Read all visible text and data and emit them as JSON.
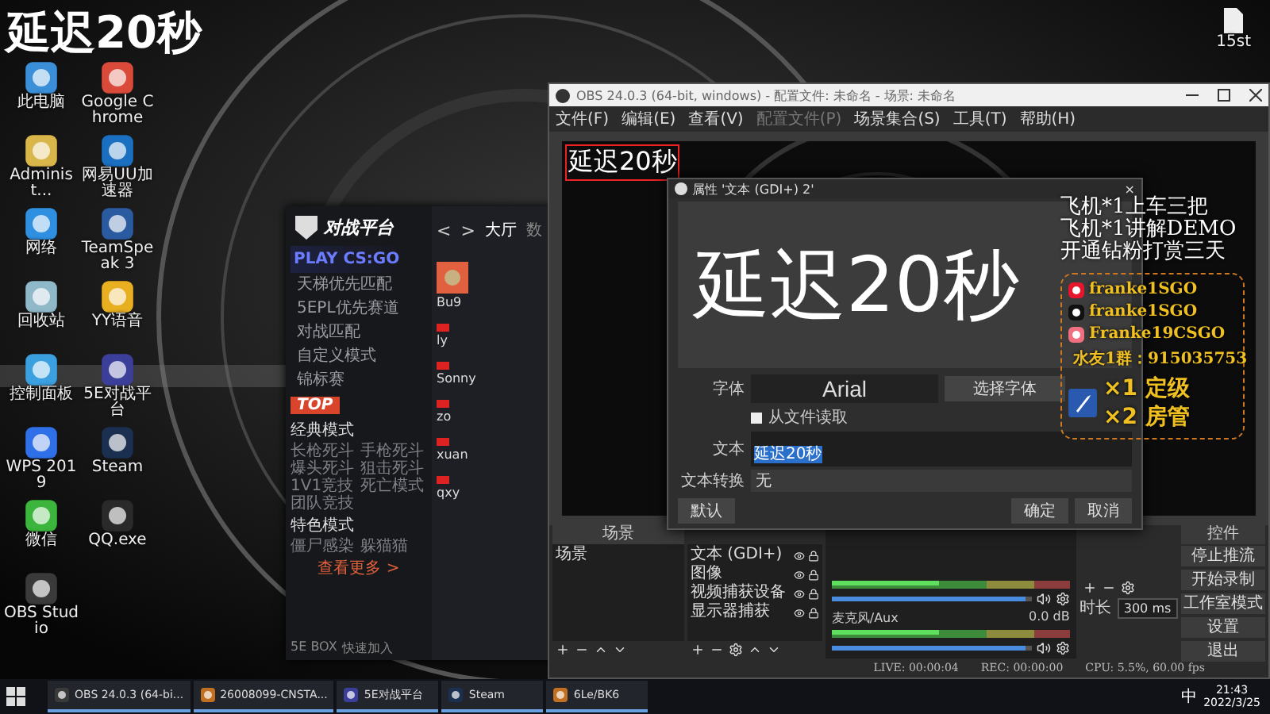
{
  "overlay_caption": "延迟20秒",
  "desktop_icons": [
    {
      "label": "此电脑",
      "kind": "computer"
    },
    {
      "label": "Google Chrome",
      "kind": "chrome"
    },
    {
      "label": "Administ...",
      "kind": "user"
    },
    {
      "label": "网易UU加速器",
      "kind": "uu"
    },
    {
      "label": "网络",
      "kind": "network"
    },
    {
      "label": "TeamSpeak 3",
      "kind": "ts"
    },
    {
      "label": "回收站",
      "kind": "bin"
    },
    {
      "label": "YY语音",
      "kind": "yy"
    },
    {
      "label": "控制面板",
      "kind": "panel"
    },
    {
      "label": "5E对战平台",
      "kind": "fivee"
    },
    {
      "label": "WPS 2019",
      "kind": "wps"
    },
    {
      "label": "Steam",
      "kind": "steam"
    },
    {
      "label": "微信",
      "kind": "wechat"
    },
    {
      "label": "QQ.exe",
      "kind": "qq"
    },
    {
      "label": "OBS Studio",
      "kind": "obs"
    }
  ],
  "file_icon": {
    "label": "15st"
  },
  "five_e": {
    "logo": "对战平台",
    "play": "PLAY CS:GO",
    "nav": {
      "back": "<",
      "forward": ">",
      "tabs": [
        {
          "label": "大厅",
          "selected": true
        },
        {
          "label": "数",
          "selected": false
        }
      ]
    },
    "menu": [
      "天梯优先匹配",
      "5EPL优先赛道",
      "对战匹配",
      "自定义模式",
      "锦标赛"
    ],
    "top_badge": "TOP",
    "sections": [
      {
        "title": "经典模式",
        "items": [
          "长枪死斗",
          "手枪死斗",
          "爆头死斗",
          "狙击死斗",
          "1V1竞技",
          "死亡模式",
          "团队竞技"
        ]
      },
      {
        "title": "特色模式",
        "items": [
          "僵尸感染",
          "躲猫猫"
        ]
      }
    ],
    "more": "查看更多 >",
    "footer": [
      "5E BOX",
      "快速加入"
    ],
    "players": [
      {
        "name": "Bu9",
        "kind": "avatar"
      },
      {
        "name": "ly",
        "kind": "flag"
      },
      {
        "name": "Sonny",
        "kind": "flag"
      },
      {
        "name": "zo",
        "kind": "flag"
      },
      {
        "name": "xuan",
        "kind": "flag"
      },
      {
        "name": "qxy",
        "kind": "flag"
      }
    ]
  },
  "obs": {
    "title": "OBS 24.0.3 (64-bit, windows) - 配置文件: 未命名 - 场景: 未命名",
    "menu": [
      {
        "label": "文件(F)",
        "disabled": false
      },
      {
        "label": "编辑(E)",
        "disabled": false
      },
      {
        "label": "查看(V)",
        "disabled": false
      },
      {
        "label": "配置文件(P)",
        "disabled": true
      },
      {
        "label": "场景集合(S)",
        "disabled": false
      },
      {
        "label": "工具(T)",
        "disabled": false
      },
      {
        "label": "帮助(H)",
        "disabled": false
      }
    ],
    "preview_selection": "延迟20秒",
    "scenes": {
      "header": "场景",
      "items": [
        "场景"
      ]
    },
    "sources": [
      "文本 (GDI+)",
      "图像",
      "视频捕获设备",
      "显示器捕获"
    ],
    "mixer": [
      {
        "level": 0.97
      },
      {
        "name": "麦克风/Aux",
        "reading": "0.0 dB",
        "level": 0.97
      }
    ],
    "transition": {
      "label": "时长",
      "value": "300 ms"
    },
    "controls": {
      "header": "控件",
      "buttons": [
        "停止推流",
        "开始录制",
        "工作室模式",
        "设置",
        "退出"
      ]
    },
    "status": [
      "LIVE: 00:00:04",
      "REC: 00:00:00",
      "CPU: 5.5%, 60.00 fps"
    ]
  },
  "props": {
    "title": "属性 '文本 (GDI+) 2'",
    "close": "×",
    "preview_text": "延迟20秒",
    "font_label": "字体",
    "font_value": "Arial",
    "font_button": "选择字体",
    "from_file": {
      "label": "从文件读取",
      "checked": false
    },
    "text_label": "文本",
    "text_value": "延迟20秒",
    "transform_label": "文本转换",
    "transform_value": "无",
    "buttons": [
      "默认",
      "确定",
      "取消"
    ]
  },
  "stream_overlay": {
    "lines": [
      "飞机*1上车三把",
      "飞机*1讲解DEMO",
      "开通钻粉打赏三天"
    ],
    "socials": [
      {
        "kind": "weibo",
        "text": "franke1SGO"
      },
      {
        "kind": "douyin",
        "text": "franke1SGO"
      },
      {
        "kind": "huya",
        "text": "Franke19CSGO"
      },
      {
        "kind": "qq",
        "text": "水友1群：915035753"
      }
    ],
    "rewards": [
      "×1 定级",
      "×2 房管"
    ]
  },
  "taskbar": {
    "items": [
      {
        "label": "OBS 24.0.3 (64-bi...",
        "kind": "obs"
      },
      {
        "label": "26008099-CNSTA...",
        "kind": "game"
      },
      {
        "label": "5E对战平台",
        "kind": "fivee"
      },
      {
        "label": "Steam",
        "kind": "steam"
      },
      {
        "label": "6Le/BK6",
        "kind": "game"
      }
    ],
    "ime": "中",
    "time": "21:43",
    "date": "2022/3/25"
  }
}
